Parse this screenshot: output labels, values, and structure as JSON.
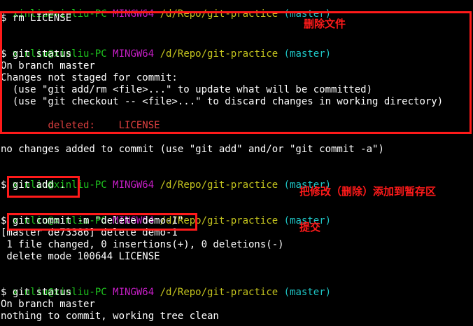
{
  "colors": {
    "background": "#000000",
    "text": "#ffffff",
    "user": "#1ec41e",
    "host": "#c51ec5",
    "path": "#c4c41e",
    "branch": "#1ec4c4",
    "deleted": "#e04040",
    "annotation": "#ff1a1a"
  },
  "prompt": {
    "user": "xinliu@xinliu-PC",
    "host": "MINGW64",
    "path": "/d/Repo/git-practice",
    "branch": "(master)"
  },
  "lines": {
    "l1": "$ rm LICENSE",
    "l2": "$ git status",
    "l3": "On branch master",
    "l4": "Changes not staged for commit:",
    "l5": "  (use \"git add/rm <file>...\" to update what will be committed)",
    "l6": "  (use \"git checkout -- <file>...\" to discard changes in working directory)",
    "l7_label": "deleted:",
    "l7_file": "LICENSE",
    "l8": "no changes added to commit (use \"git add\" and/or \"git commit -a\")",
    "l9": "$ git add .",
    "l10": "$ git commit -m \"delete demo-1\"",
    "l11": "[master de73386] delete demo-1",
    "l12": " 1 file changed, 0 insertions(+), 0 deletions(-)",
    "l13": " delete mode 100644 LICENSE",
    "l14": "$ git status",
    "l15": "On branch master",
    "l16": "nothing to commit, working tree clean"
  },
  "annotations": {
    "delete_file": "删除文件",
    "add_to_stage": "把修改（删除）添加到暂存区",
    "commit": "提交"
  }
}
